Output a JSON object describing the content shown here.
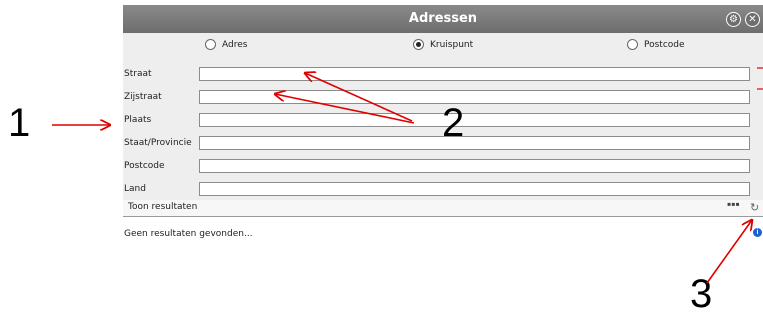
{
  "window": {
    "title": "Adressen"
  },
  "icons": {
    "settings": "gear-icon",
    "close": "close-icon",
    "more": "more-dots-icon",
    "refresh": "refresh-icon",
    "info": "info-icon"
  },
  "search_mode": {
    "options": [
      {
        "label": "Adres",
        "selected": false
      },
      {
        "label": "Kruispunt",
        "selected": true
      },
      {
        "label": "Postcode",
        "selected": false
      }
    ]
  },
  "fields": [
    {
      "label": "Straat",
      "value": ""
    },
    {
      "label": "Zijstraat",
      "value": ""
    },
    {
      "label": "Plaats",
      "value": ""
    },
    {
      "label": "Staat/Provincie",
      "value": ""
    },
    {
      "label": "Postcode",
      "value": ""
    },
    {
      "label": "Land",
      "value": ""
    }
  ],
  "results": {
    "toggle_label": "Toon resultaten",
    "more_label": "▪▪▪",
    "empty_message": "Geen resultaten gevonden..."
  },
  "annotations": {
    "one": "1",
    "two": "2",
    "three": "3"
  },
  "colors": {
    "titlebar": "#7a7a7a",
    "form_bg": "#eeeeee",
    "arrow": "#e00000"
  }
}
